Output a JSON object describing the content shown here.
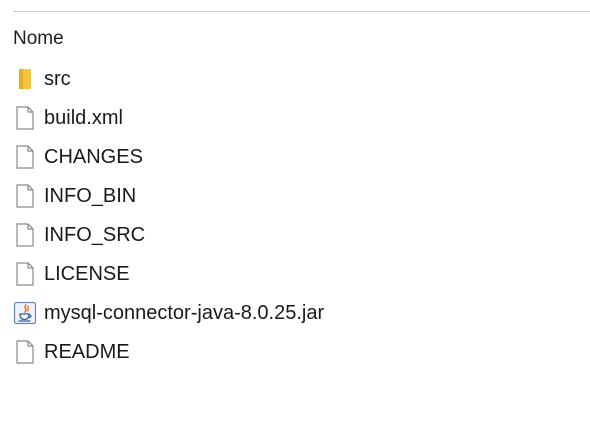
{
  "header": {
    "name_column": "Nome"
  },
  "files": [
    {
      "name": "src",
      "icon": "folder-icon"
    },
    {
      "name": "build.xml",
      "icon": "file-icon"
    },
    {
      "name": "CHANGES",
      "icon": "file-icon"
    },
    {
      "name": "INFO_BIN",
      "icon": "file-icon"
    },
    {
      "name": "INFO_SRC",
      "icon": "file-icon"
    },
    {
      "name": "LICENSE",
      "icon": "file-icon"
    },
    {
      "name": "mysql-connector-java-8.0.25.jar",
      "icon": "java-jar-icon"
    },
    {
      "name": "README",
      "icon": "file-icon"
    }
  ],
  "colors": {
    "folder": "#f5c542",
    "file_outline": "#8a8a8a",
    "java_accent": "#e8711c"
  }
}
